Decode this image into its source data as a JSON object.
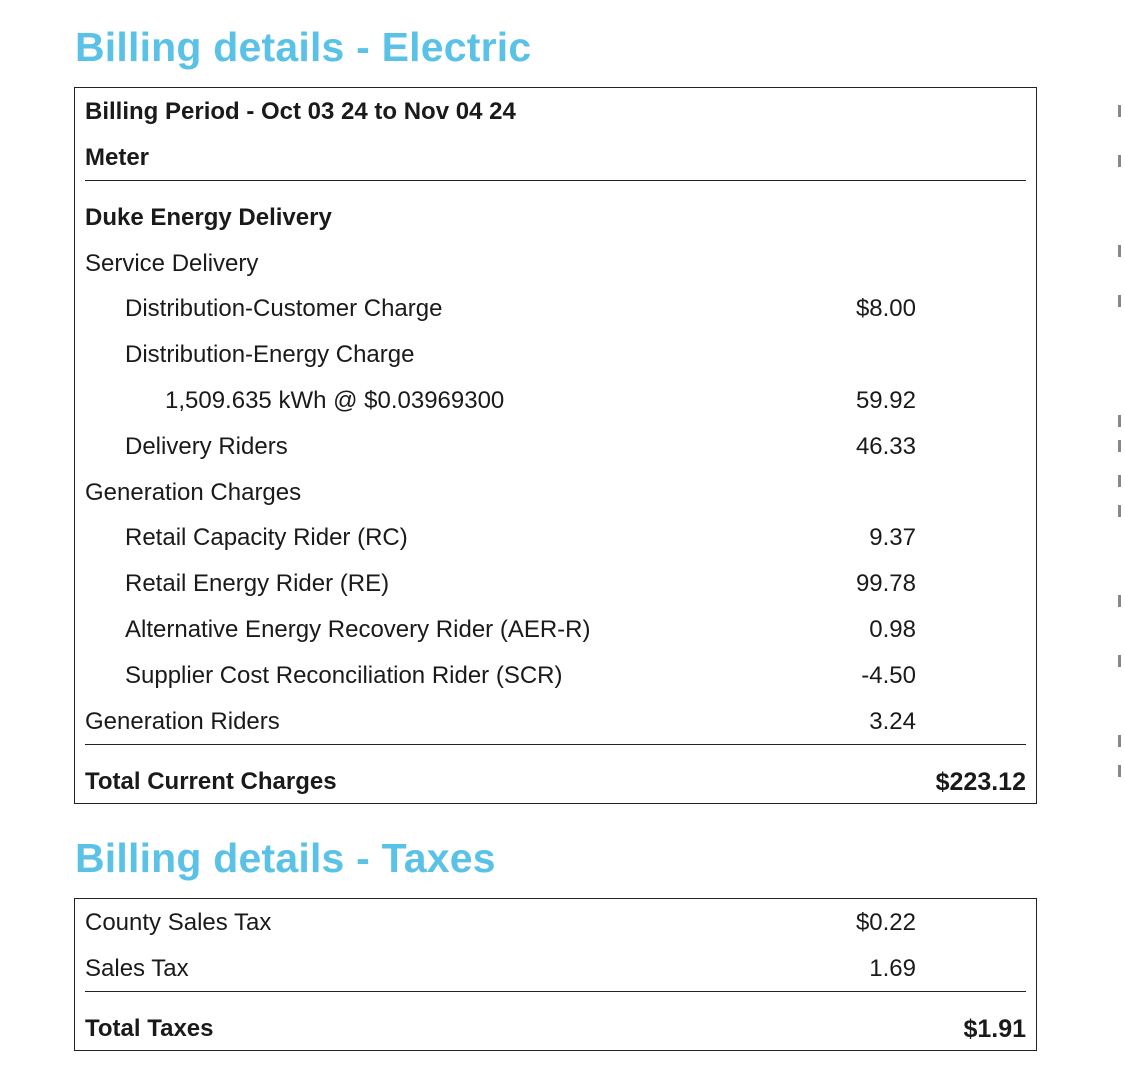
{
  "electric": {
    "title": "Billing details - Electric",
    "billing_period": "Billing Period - Oct 03 24 to Nov 04 24",
    "meter_label": "Meter",
    "provider": "Duke Energy Delivery",
    "service_delivery": {
      "label": "Service Delivery",
      "distribution_customer": {
        "label": "Distribution-Customer Charge",
        "amount": "$8.00"
      },
      "distribution_energy": {
        "label": "Distribution-Energy Charge"
      },
      "usage": {
        "label": "1,509.635 kWh @ $0.03969300",
        "amount": "59.92"
      },
      "delivery_riders": {
        "label": "Delivery Riders",
        "amount": "46.33"
      }
    },
    "generation_charges": {
      "label": "Generation Charges",
      "retail_capacity": {
        "label": "Retail Capacity Rider (RC)",
        "amount": "9.37"
      },
      "retail_energy": {
        "label": "Retail Energy Rider (RE)",
        "amount": "99.78"
      },
      "alternative_energy": {
        "label": "Alternative Energy Recovery Rider (AER-R)",
        "amount": "0.98"
      },
      "supplier_cost": {
        "label": "Supplier Cost Reconciliation Rider (SCR)",
        "amount": "-4.50"
      }
    },
    "generation_riders": {
      "label": "Generation Riders",
      "amount": "3.24"
    },
    "total": {
      "label": "Total Current Charges",
      "amount": "$223.12"
    }
  },
  "taxes": {
    "title": "Billing details - Taxes",
    "county_sales_tax": {
      "label": "County Sales Tax",
      "amount": "$0.22"
    },
    "sales_tax": {
      "label": "Sales Tax",
      "amount": "1.69"
    },
    "total": {
      "label": "Total Taxes",
      "amount": "$1.91"
    }
  },
  "colors": {
    "heading": "#5bc2e7",
    "text": "#1a1a1a",
    "border": "#222222"
  }
}
